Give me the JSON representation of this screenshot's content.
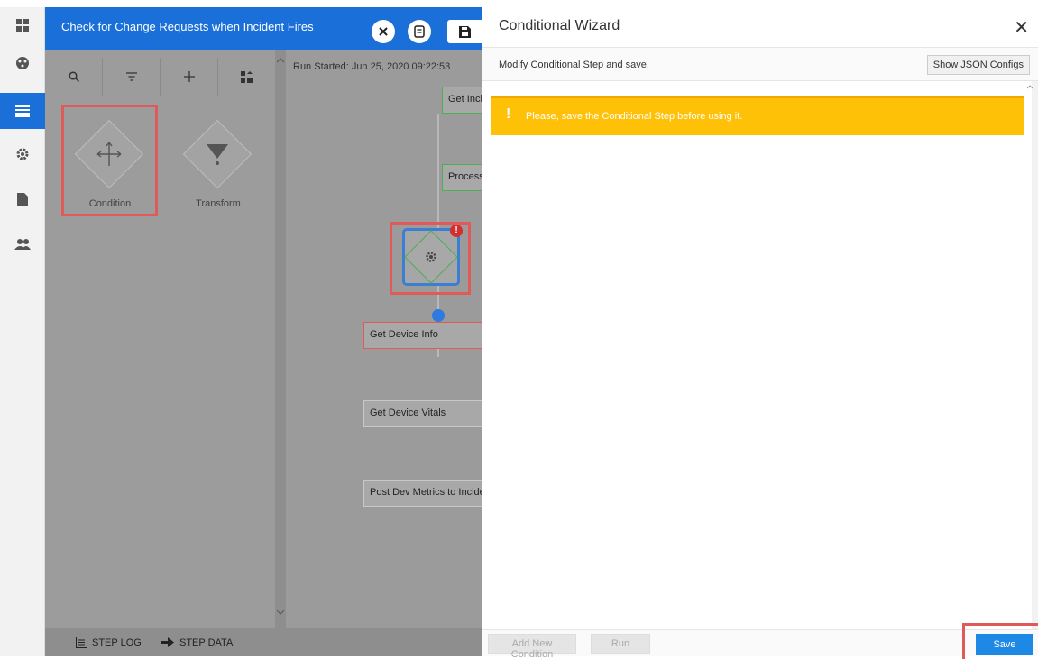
{
  "titlebar": {
    "title": "Check for Change Requests when Incident Fires"
  },
  "palette": {
    "items": [
      {
        "label": "Condition"
      },
      {
        "label": "Transform"
      }
    ]
  },
  "canvas": {
    "run_started": "Run Started: Jun 25, 2020 09:22:53",
    "steps": [
      {
        "label": "Get Incident Info"
      },
      {
        "label": "Process Incident"
      },
      {
        "label": "Get Device Info"
      },
      {
        "label": "Get Device Vitals"
      },
      {
        "label": "Post Dev Metrics to Incident"
      }
    ],
    "error_badge": "!"
  },
  "bottombar": {
    "step_log": "STEP LOG",
    "step_data": "STEP DATA"
  },
  "wizard": {
    "title": "Conditional Wizard",
    "close": "✕",
    "subtitle": "Modify Conditional Step and save.",
    "show_json": "Show JSON Configs",
    "warning_icon": "!",
    "warning": "Please, save the Conditional Step before using it.",
    "add_condition": "Add New Condition",
    "run": "Run",
    "save": "Save"
  },
  "colors": {
    "accent": "#1b6fd8",
    "warning": "#ffc107",
    "highlight": "#e05a5a"
  }
}
